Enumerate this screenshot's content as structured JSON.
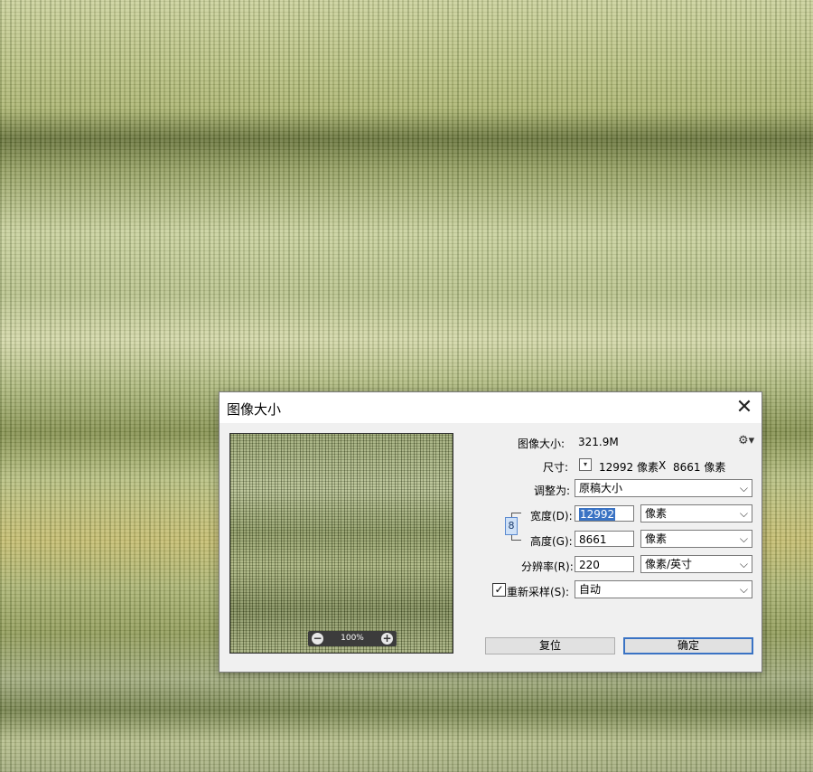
{
  "dialog": {
    "title": "图像大小",
    "close_glyph": "✕",
    "zoom": {
      "minus": "−",
      "level": "100%",
      "plus": "+"
    },
    "image_size": {
      "label": "图像大小:",
      "value": "321.9M"
    },
    "dimensions": {
      "label": "尺寸:",
      "dropdown_glyph": "▾",
      "width_value": "12992 像素",
      "separator": "X",
      "height_value": "8661 像素"
    },
    "fit_to": {
      "label": "调整为:",
      "value": "原稿大小"
    },
    "width": {
      "label": "宽度(D):",
      "value": "12992",
      "unit": "像素"
    },
    "height": {
      "label": "高度(G):",
      "value": "8661",
      "unit": "像素"
    },
    "resolution": {
      "label": "分辨率(R):",
      "value": "220",
      "unit": "像素/英寸"
    },
    "resample": {
      "label": "重新采样(S):",
      "checked": true,
      "check_glyph": "✓",
      "value": "自动"
    },
    "link_glyph": "8",
    "gear_glyph": "⚙▾",
    "dropdown_arrow": "⌵",
    "buttons": {
      "reset": "复位",
      "ok": "确定"
    }
  }
}
